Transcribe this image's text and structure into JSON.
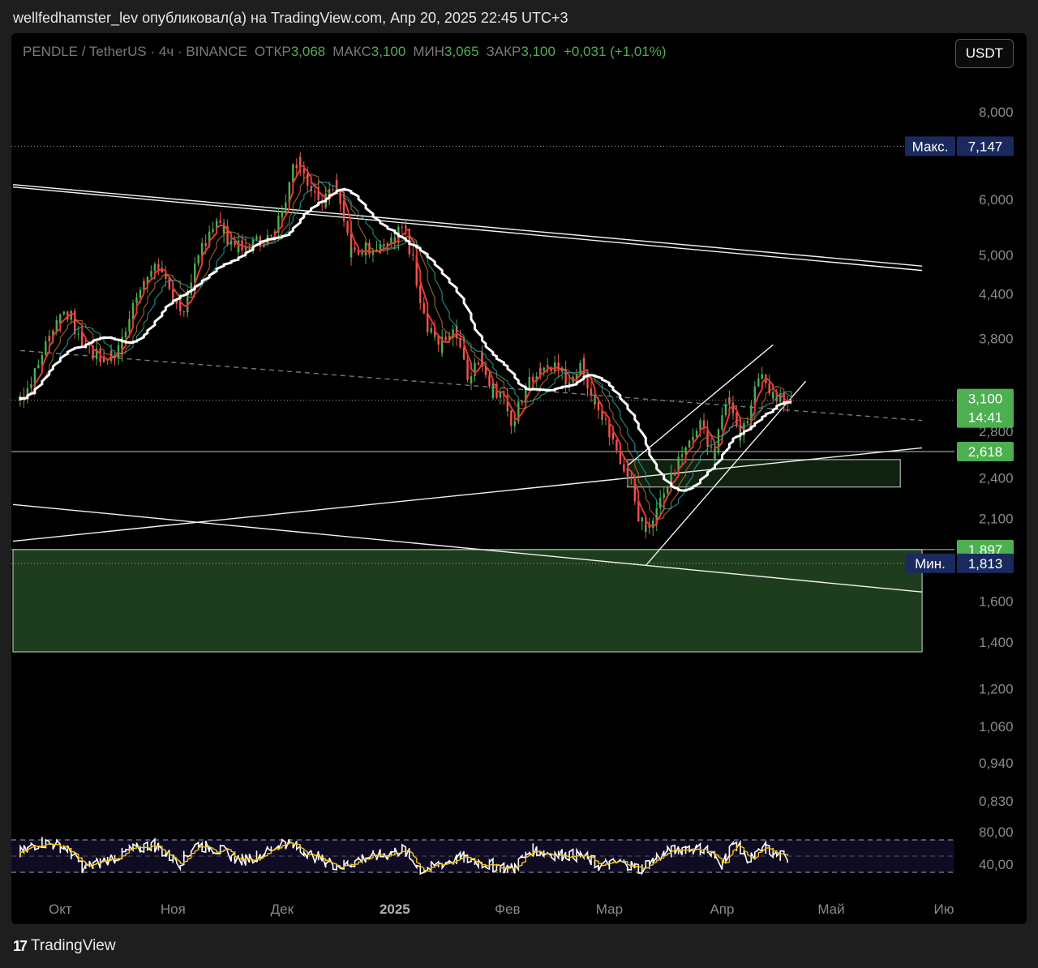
{
  "header": {
    "published": "wellfedhamster_lev опубликовал(а) на TradingView.com, Апр 20, 2025 22:45 UTC+3"
  },
  "legend": {
    "symbol": "PENDLE / TetherUS · 4ч · BINANCE",
    "open_label": "ОТКР",
    "open": "3,068",
    "high_label": "МАКС",
    "high": "3,100",
    "low_label": "МИН",
    "low": "3,065",
    "close_label": "ЗАКР",
    "close": "3,100",
    "change": "+0,031 (+1,01%)"
  },
  "currency_button": "USDT",
  "brand": {
    "logo": "17",
    "name": "TradingView"
  },
  "colors": {
    "up": "#4caf50",
    "down": "#ef5350",
    "ema_fast": "#e53935",
    "ema_mid": "#b87333",
    "ema_teal": "#26a69a",
    "ema_slow": "#ffffff",
    "zone": "#1e3d1e",
    "rsi": "#ffffff",
    "rsi_ma": "#f5c518",
    "axis_text": "#8a8a8a",
    "badge_blue": "#1a2a5e",
    "badge_green": "#4caf50"
  },
  "chart_data": {
    "type": "candlestick",
    "symbol": "PENDLE / TetherUS",
    "timeframe": "4ч",
    "exchange": "BINANCE",
    "y_scale": "log",
    "ylim": [
      0.77,
      8.6
    ],
    "y_ticks": [
      "8,000",
      "6,000",
      "5,000",
      "4,400",
      "3,800",
      "2,800",
      "2,400",
      "2,100",
      "1,600",
      "1,400",
      "1,200",
      "1,060",
      "0,940",
      "0,830"
    ],
    "x_ticks": [
      {
        "label": "Окт",
        "date": "2024-10-01"
      },
      {
        "label": "Ноя",
        "date": "2024-11-01"
      },
      {
        "label": "Дек",
        "date": "2024-12-01"
      },
      {
        "label": "2025",
        "date": "2025-01-01"
      },
      {
        "label": "Фев",
        "date": "2025-02-01"
      },
      {
        "label": "Мар",
        "date": "2025-03-01"
      },
      {
        "label": "Апр",
        "date": "2025-04-01"
      },
      {
        "label": "Май",
        "date": "2025-05-01"
      },
      {
        "label": "Ию",
        "date": "2025-06-01"
      }
    ],
    "price_path": [
      [
        "2024-09-20",
        3.1
      ],
      [
        "2024-09-24",
        3.3
      ],
      [
        "2024-09-28",
        3.8
      ],
      [
        "2024-10-03",
        4.2
      ],
      [
        "2024-10-07",
        3.8
      ],
      [
        "2024-10-12",
        3.55
      ],
      [
        "2024-10-18",
        3.65
      ],
      [
        "2024-10-24",
        4.6
      ],
      [
        "2024-10-29",
        4.8
      ],
      [
        "2024-11-01",
        4.4
      ],
      [
        "2024-11-05",
        4.15
      ],
      [
        "2024-11-09",
        5.1
      ],
      [
        "2024-11-13",
        5.6
      ],
      [
        "2024-11-17",
        5.25
      ],
      [
        "2024-11-21",
        5.05
      ],
      [
        "2024-11-25",
        5.25
      ],
      [
        "2024-11-29",
        5.3
      ],
      [
        "2024-12-03",
        6.2
      ],
      [
        "2024-12-06",
        6.9
      ],
      [
        "2024-12-09",
        6.3
      ],
      [
        "2024-12-13",
        6.0
      ],
      [
        "2024-12-16",
        6.4
      ],
      [
        "2024-12-18",
        5.9
      ],
      [
        "2024-12-20",
        5.0
      ],
      [
        "2024-12-24",
        5.1
      ],
      [
        "2024-12-28",
        5.15
      ],
      [
        "2025-01-01",
        5.2
      ],
      [
        "2025-01-04",
        5.5
      ],
      [
        "2025-01-07",
        4.7
      ],
      [
        "2025-01-10",
        3.9
      ],
      [
        "2025-01-14",
        3.7
      ],
      [
        "2025-01-18",
        3.9
      ],
      [
        "2025-01-22",
        3.3
      ],
      [
        "2025-01-25",
        3.6
      ],
      [
        "2025-01-28",
        3.2
      ],
      [
        "2025-01-31",
        3.2
      ],
      [
        "2025-02-03",
        2.8
      ],
      [
        "2025-02-06",
        3.2
      ],
      [
        "2025-02-10",
        3.45
      ],
      [
        "2025-02-14",
        3.5
      ],
      [
        "2025-02-18",
        3.3
      ],
      [
        "2025-02-22",
        3.5
      ],
      [
        "2025-02-25",
        3.1
      ],
      [
        "2025-03-01",
        2.8
      ],
      [
        "2025-03-04",
        2.6
      ],
      [
        "2025-03-08",
        2.3
      ],
      [
        "2025-03-11",
        2.0
      ],
      [
        "2025-03-14",
        2.1
      ],
      [
        "2025-03-18",
        2.4
      ],
      [
        "2025-03-22",
        2.6
      ],
      [
        "2025-03-26",
        2.9
      ],
      [
        "2025-03-30",
        2.55
      ],
      [
        "2025-04-03",
        3.2
      ],
      [
        "2025-04-06",
        2.7
      ],
      [
        "2025-04-09",
        3.0
      ],
      [
        "2025-04-12",
        3.4
      ],
      [
        "2025-04-15",
        3.2
      ],
      [
        "2025-04-20",
        3.1
      ]
    ],
    "moving_averages": [
      {
        "color": "#e53935",
        "lag": 2
      },
      {
        "color": "#b87333",
        "lag": 5
      },
      {
        "color": "#26a69a",
        "lag": 8
      },
      {
        "color": "#ffffff",
        "lag": 14
      }
    ],
    "lines": [
      {
        "from": [
          "2024-09-18",
          6.3
        ],
        "to": [
          "2025-05-26",
          4.82
        ],
        "style": "solid"
      },
      {
        "from": [
          "2024-09-18",
          6.25
        ],
        "to": [
          "2025-05-26",
          4.75
        ],
        "style": "solid"
      },
      {
        "from": [
          "2024-09-18",
          1.95
        ],
        "to": [
          "2025-05-26",
          2.65
        ],
        "style": "solid"
      },
      {
        "from": [
          "2024-09-18",
          2.2
        ],
        "to": [
          "2025-05-26",
          1.65
        ],
        "style": "solid"
      },
      {
        "from": [
          "2024-09-20",
          3.65
        ],
        "to": [
          "2025-05-26",
          2.9
        ],
        "style": "dashed"
      },
      {
        "from": [
          "2025-03-06",
          2.5
        ],
        "to": [
          "2025-04-15",
          3.72
        ],
        "style": "solid"
      },
      {
        "from": [
          "2025-03-11",
          1.8
        ],
        "to": [
          "2025-04-24",
          3.3
        ],
        "style": "solid"
      }
    ],
    "horizontal_levels": [
      {
        "value": 7.147,
        "style": "dotted"
      },
      {
        "value": 3.1,
        "style": "dotted"
      },
      {
        "value": 2.618,
        "style": "solid"
      },
      {
        "value": 1.897,
        "style": "solid"
      },
      {
        "value": 1.813,
        "style": "dotted"
      }
    ],
    "zones": [
      {
        "from_date": "2025-03-06",
        "to_date": "2025-05-20",
        "top": 2.55,
        "bottom": 2.33
      },
      {
        "from_date": "2024-09-18",
        "to_date": "2025-05-26",
        "top": 1.897,
        "bottom": 1.355
      }
    ],
    "price_labels": [
      {
        "value": 7.147,
        "label": "Макс.",
        "text": "7,147",
        "style": "blue"
      },
      {
        "value": 3.1,
        "text": "3,100",
        "countdown": "14:41",
        "style": "green"
      },
      {
        "value": 2.618,
        "text": "2,618",
        "style": "green"
      },
      {
        "value": 1.897,
        "text": "1,897",
        "style": "green"
      },
      {
        "value": 1.813,
        "label": "Мин.",
        "text": "1,813",
        "style": "blue"
      }
    ],
    "rsi": {
      "upper_band": 70,
      "lower_band": 30,
      "mid": 50,
      "ticks": [
        "80,00",
        "40,00"
      ],
      "path": [
        [
          "2024-09-20",
          52
        ],
        [
          "2024-09-26",
          68
        ],
        [
          "2024-10-03",
          60
        ],
        [
          "2024-10-08",
          35
        ],
        [
          "2024-10-14",
          45
        ],
        [
          "2024-10-20",
          55
        ],
        [
          "2024-10-27",
          65
        ],
        [
          "2024-11-03",
          42
        ],
        [
          "2024-11-08",
          64
        ],
        [
          "2024-11-14",
          58
        ],
        [
          "2024-11-20",
          45
        ],
        [
          "2024-11-26",
          52
        ],
        [
          "2024-12-02",
          68
        ],
        [
          "2024-12-08",
          55
        ],
        [
          "2024-12-13",
          44
        ],
        [
          "2024-12-18",
          38
        ],
        [
          "2024-12-24",
          48
        ],
        [
          "2024-12-30",
          52
        ],
        [
          "2025-01-04",
          58
        ],
        [
          "2025-01-09",
          32
        ],
        [
          "2025-01-15",
          42
        ],
        [
          "2025-01-20",
          48
        ],
        [
          "2025-01-27",
          40
        ],
        [
          "2025-02-03",
          34
        ],
        [
          "2025-02-08",
          58
        ],
        [
          "2025-02-15",
          52
        ],
        [
          "2025-02-22",
          50
        ],
        [
          "2025-02-27",
          38
        ],
        [
          "2025-03-05",
          42
        ],
        [
          "2025-03-10",
          34
        ],
        [
          "2025-03-16",
          52
        ],
        [
          "2025-03-22",
          60
        ],
        [
          "2025-03-28",
          58
        ],
        [
          "2025-04-01",
          40
        ],
        [
          "2025-04-05",
          66
        ],
        [
          "2025-04-09",
          44
        ],
        [
          "2025-04-13",
          60
        ],
        [
          "2025-04-17",
          50
        ],
        [
          "2025-04-20",
          48
        ]
      ]
    }
  }
}
